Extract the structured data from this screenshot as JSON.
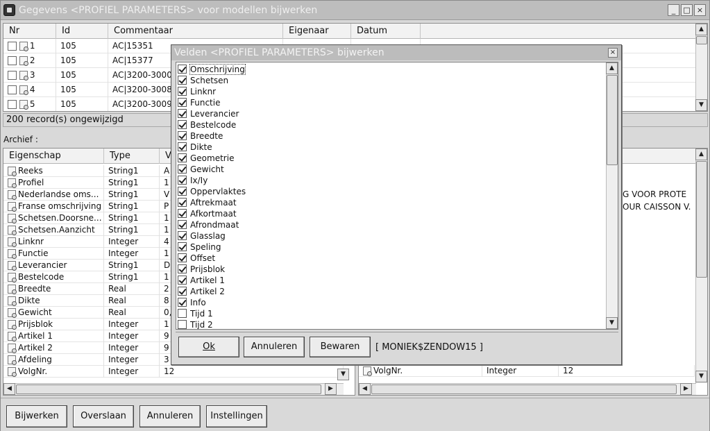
{
  "window": {
    "title": "Gegevens <PROFIEL PARAMETERS> voor modellen bijwerken",
    "minimize": "_",
    "maximize": "□",
    "close": "×"
  },
  "top_grid": {
    "columns": [
      "Nr",
      "Id",
      "Commentaar",
      "Eigenaar",
      "Datum"
    ],
    "rows": [
      {
        "nr": "1",
        "id": "105",
        "comment": "AC|15351"
      },
      {
        "nr": "2",
        "id": "105",
        "comment": "AC|15377"
      },
      {
        "nr": "3",
        "id": "105",
        "comment": "AC|3200-3000"
      },
      {
        "nr": "4",
        "id": "105",
        "comment": "AC|3200-3008"
      },
      {
        "nr": "5",
        "id": "105",
        "comment": "AC|3200-3009"
      }
    ]
  },
  "status": {
    "text": "200 record(s) ongewijzigd"
  },
  "archief_label": "Archief :",
  "left_grid": {
    "columns": [
      "Eigenschap",
      "Type",
      "V"
    ],
    "rows": [
      {
        "name": "Reeks",
        "type": "String1",
        "value": "A"
      },
      {
        "name": "Profiel",
        "type": "String1",
        "value": "1"
      },
      {
        "name": "Nederlandse oms...",
        "type": "String1",
        "value": "V"
      },
      {
        "name": "Franse omschrijving",
        "type": "String1",
        "value": "P"
      },
      {
        "name": "Schetsen.Doorsne...",
        "type": "String1",
        "value": "1"
      },
      {
        "name": "Schetsen.Aanzicht",
        "type": "String1",
        "value": "1"
      },
      {
        "name": "Linknr",
        "type": "Integer",
        "value": "4"
      },
      {
        "name": "Functie",
        "type": "Integer",
        "value": "1"
      },
      {
        "name": "Leverancier",
        "type": "String1",
        "value": "D"
      },
      {
        "name": "Bestelcode",
        "type": "String1",
        "value": "1"
      },
      {
        "name": "Breedte",
        "type": "Real",
        "value": "2"
      },
      {
        "name": "Dikte",
        "type": "Real",
        "value": "8"
      },
      {
        "name": "Gewicht",
        "type": "Real",
        "value": "0,"
      },
      {
        "name": "Prijsblok",
        "type": "Integer",
        "value": "1"
      },
      {
        "name": "Artikel 1",
        "type": "Integer",
        "value": "9"
      },
      {
        "name": "Artikel 2",
        "type": "Integer",
        "value": "9"
      },
      {
        "name": "Afdeling",
        "type": "Integer",
        "value": "3"
      },
      {
        "name": "VolgNr.",
        "type": "Integer",
        "value": "12"
      }
    ]
  },
  "right_grid": {
    "visible_text": [
      {
        "text": "G VOOR PROTE"
      },
      {
        "text": "OUR CAISSON V."
      }
    ],
    "last_row": {
      "name": "VolgNr.",
      "type": "Integer",
      "value": "12"
    }
  },
  "buttons": {
    "bijwerken": "Bijwerken",
    "overslaan": "Overslaan",
    "annuleren": "Annuleren",
    "instellingen": "Instellingen"
  },
  "dialog": {
    "title": "Velden <PROFIEL PARAMETERS> bijwerken",
    "close": "×",
    "fields": [
      {
        "label": "Omschrijving",
        "checked": true
      },
      {
        "label": "Schetsen",
        "checked": true
      },
      {
        "label": "Linknr",
        "checked": true
      },
      {
        "label": "Functie",
        "checked": true
      },
      {
        "label": "Leverancier",
        "checked": true
      },
      {
        "label": "Bestelcode",
        "checked": true
      },
      {
        "label": "Breedte",
        "checked": true
      },
      {
        "label": "Dikte",
        "checked": true
      },
      {
        "label": "Geometrie",
        "checked": true
      },
      {
        "label": "Gewicht",
        "checked": true
      },
      {
        "label": "Ix/Iy",
        "checked": true
      },
      {
        "label": "Oppervlaktes",
        "checked": true
      },
      {
        "label": "Aftrekmaat",
        "checked": true
      },
      {
        "label": "Afkortmaat",
        "checked": true
      },
      {
        "label": "Afrondmaat",
        "checked": true
      },
      {
        "label": "Glasslag",
        "checked": true
      },
      {
        "label": "Speling",
        "checked": true
      },
      {
        "label": "Offset",
        "checked": true
      },
      {
        "label": "Prijsblok",
        "checked": true
      },
      {
        "label": "Artikel 1",
        "checked": true
      },
      {
        "label": "Artikel 2",
        "checked": true
      },
      {
        "label": "Info",
        "checked": true
      },
      {
        "label": "Tijd 1",
        "checked": false
      },
      {
        "label": "Tijd 2",
        "checked": false
      }
    ],
    "ok": "Ok",
    "annuleren": "Annuleren",
    "bewaren": "Bewaren",
    "user": "[ MONIEK$ZENDOW15 ]"
  },
  "colors": {
    "title_bg": "#bdbdbd",
    "window_bg": "#d9d9d9"
  }
}
